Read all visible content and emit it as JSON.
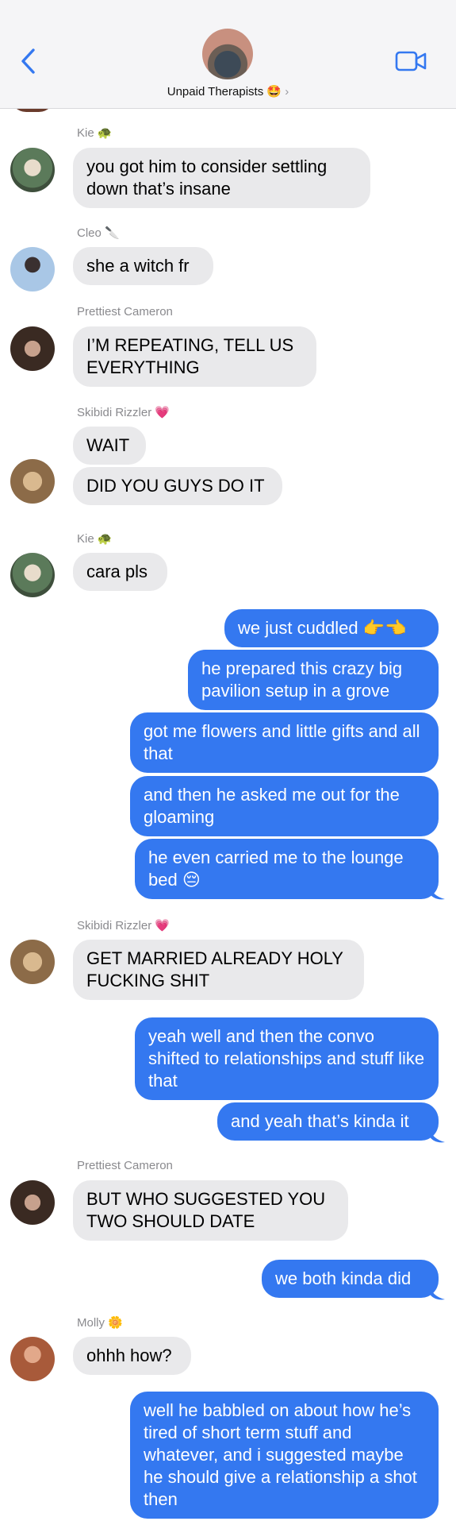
{
  "header": {
    "group_name": "Unpaid Therapists 🤩",
    "chevron": "›",
    "back_icon": "chevron-left-icon",
    "video_icon": "video-camera-icon",
    "accent": "#3478f0"
  },
  "messages": [
    {
      "sender": "Kie 🐢",
      "text": "you got him to consider settling down that’s insane"
    },
    {
      "sender": "Cleo 🔪",
      "text": "she a witch fr"
    },
    {
      "sender": "Prettiest Cameron",
      "text": "I’M REPEATING, TELL US EVERYTHING"
    },
    {
      "sender": "Skibidi Rizzler 💗",
      "text": "WAIT"
    },
    {
      "text": "DID YOU GUYS DO IT"
    },
    {
      "sender": "Kie 🐢",
      "text": "cara pls"
    },
    {
      "text": "we just cuddled 👉👈"
    },
    {
      "text": "he prepared this crazy big pavilion setup in a grove"
    },
    {
      "text": "got me flowers and little gifts and all that"
    },
    {
      "text": "and then he asked me out for the gloaming"
    },
    {
      "text": "he even carried me to the lounge bed 😔"
    },
    {
      "sender": "Skibidi Rizzler 💗",
      "text": "GET MARRIED ALREADY HOLY FUCKING SHIT"
    },
    {
      "text": "yeah well and then the convo shifted to relationships and stuff like that"
    },
    {
      "text": "and yeah that’s kinda it"
    },
    {
      "sender": "Prettiest Cameron",
      "text": "BUT WHO SUGGESTED YOU TWO SHOULD DATE"
    },
    {
      "text": "we both kinda did"
    },
    {
      "sender": "Molly 🌼",
      "text": "ohhh how?"
    },
    {
      "text": "well he babbled on about how he’s tired of short term stuff and whatever, and i suggested maybe he should give a relationship a shot then"
    }
  ],
  "colors": {
    "incoming_bubble": "#e9e9eb",
    "outgoing_bubble": "#3478f0"
  }
}
